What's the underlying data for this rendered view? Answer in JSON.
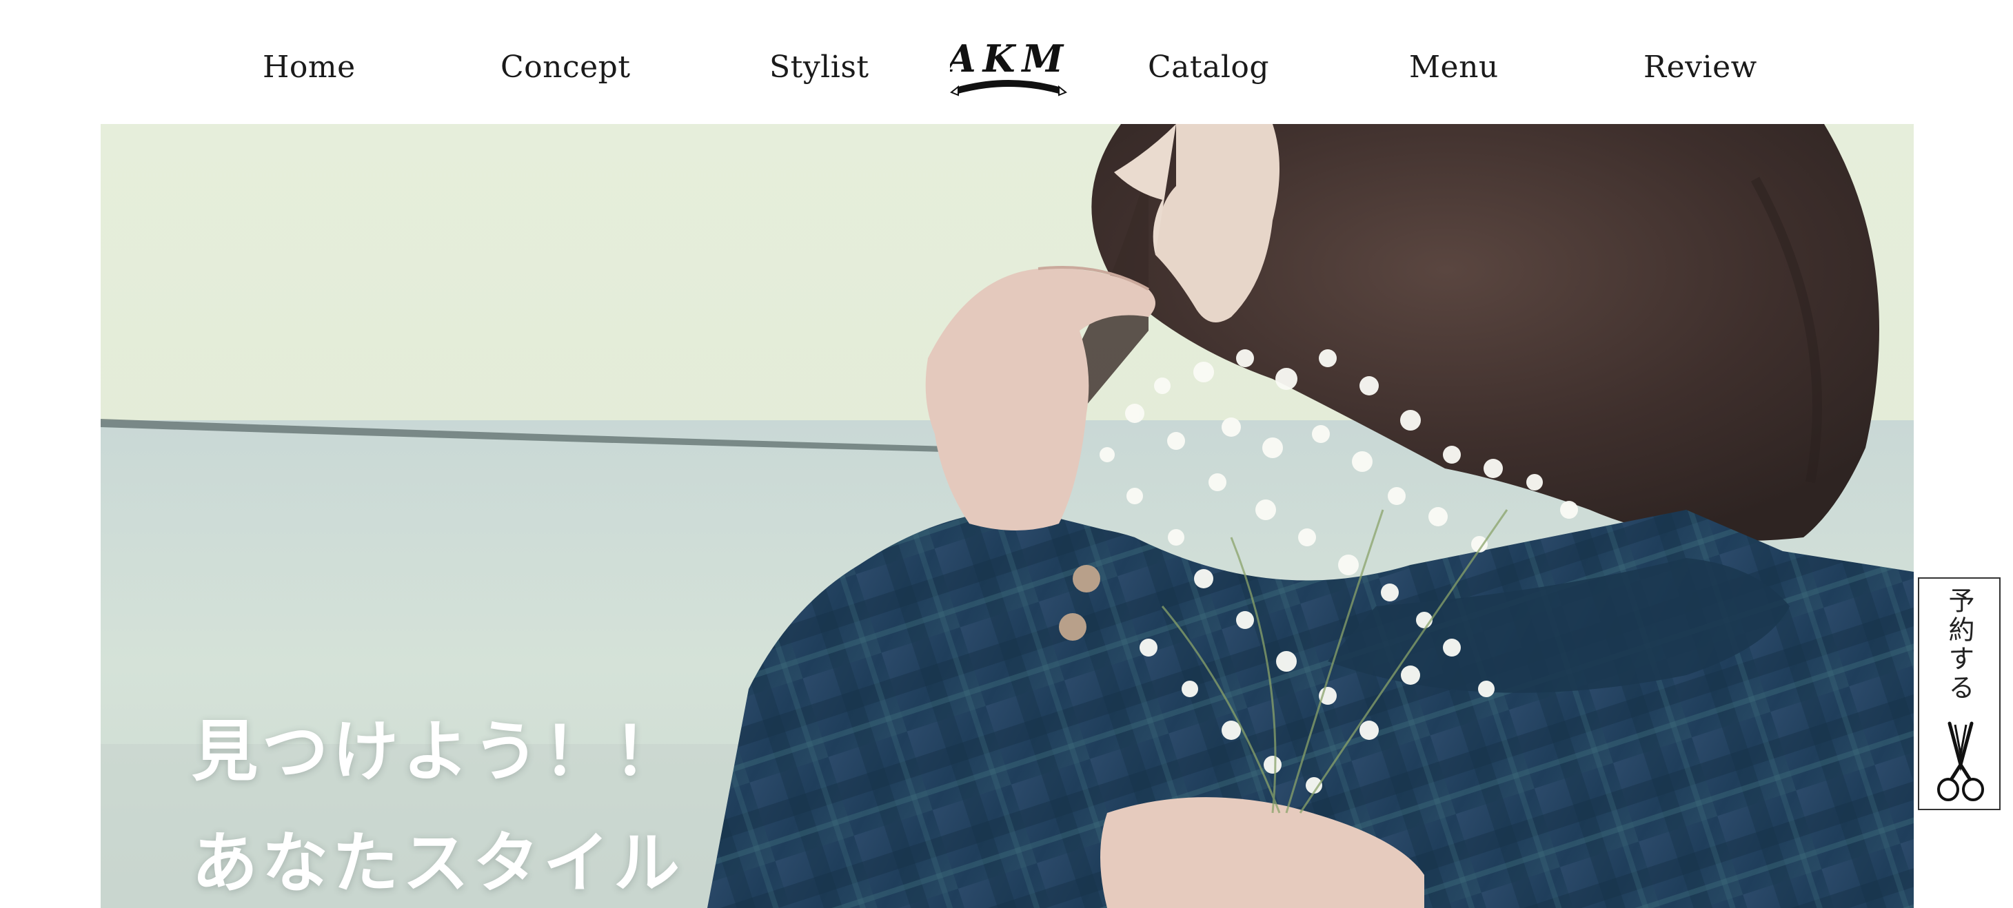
{
  "nav": {
    "items": [
      {
        "label": "Home"
      },
      {
        "label": "Concept"
      },
      {
        "label": "Stylist"
      },
      {
        "label": "Catalog"
      },
      {
        "label": "Menu"
      },
      {
        "label": "Review"
      }
    ],
    "logo_text": "AKM"
  },
  "hero": {
    "heading_line1": "見つけよう！！",
    "heading_line2": "あなたスタイル"
  },
  "reserve": {
    "label": "予約する",
    "icon": "scissors-icon"
  },
  "colors": {
    "text": "#1a1a1a",
    "hero_text": "#ffffff",
    "border": "#333333"
  }
}
